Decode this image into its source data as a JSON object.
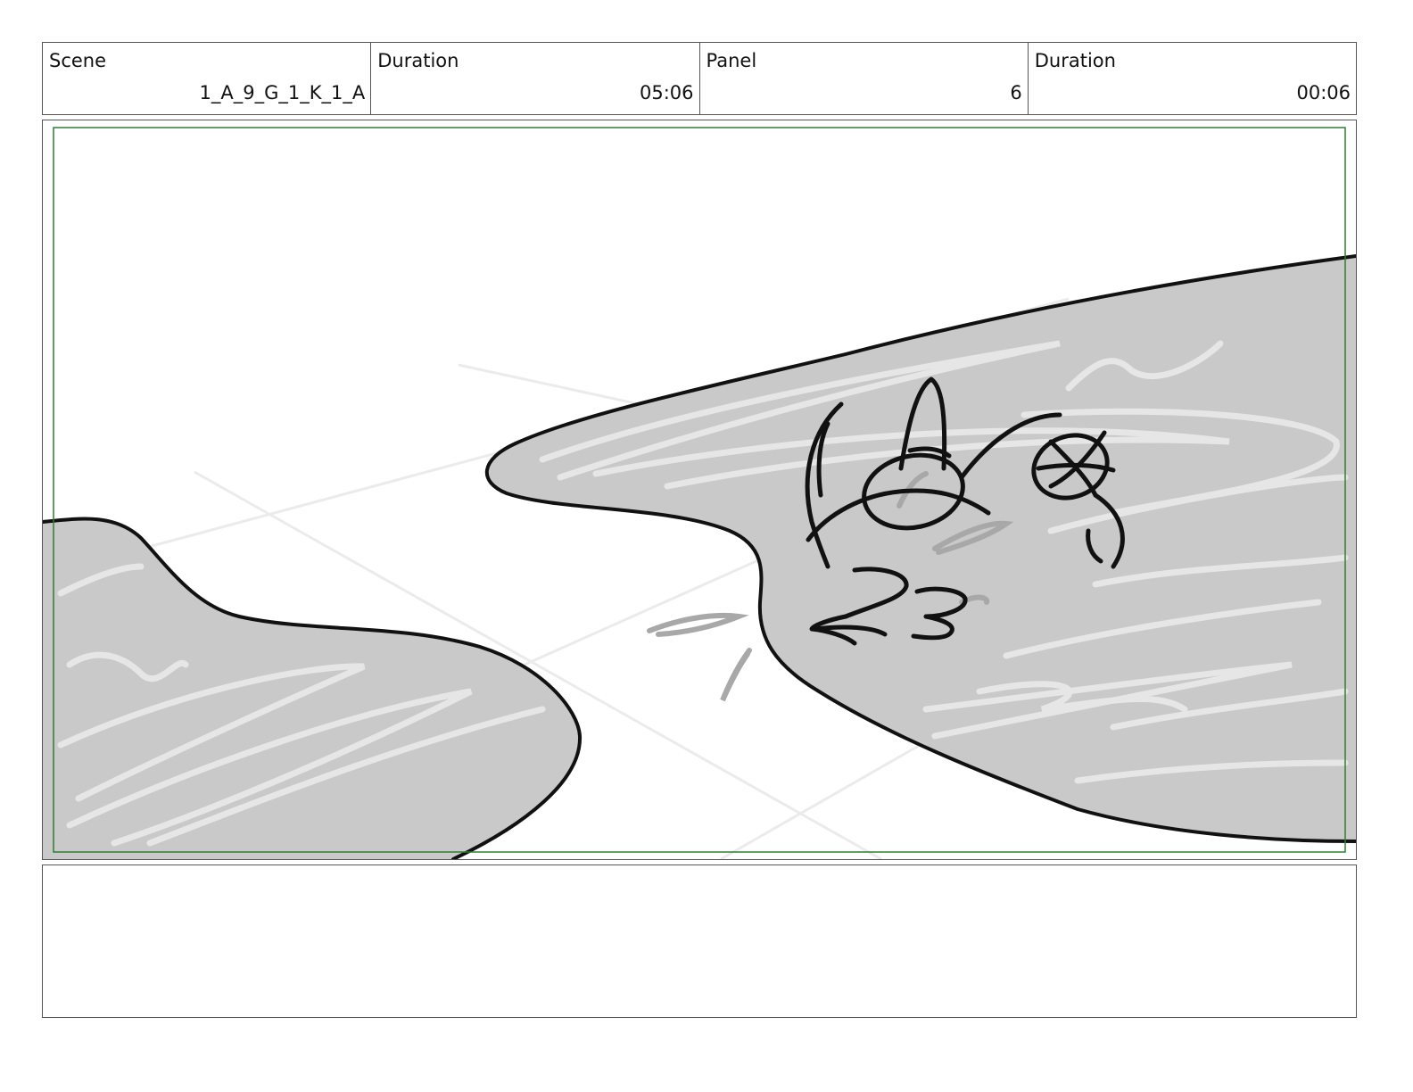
{
  "header": {
    "scene_label": "Scene",
    "scene_value": "1_A_9_G_1_K_1_A",
    "scene_duration_label": "Duration",
    "scene_duration_value": "05:06",
    "panel_label": "Panel",
    "panel_value": "6",
    "panel_duration_label": "Duration",
    "panel_duration_value": "00:06"
  },
  "colors": {
    "safe_area_border": "#2e7d32",
    "landmass_fill": "#c9c9c9",
    "outline": "#111111"
  },
  "notes": {
    "text": ""
  }
}
